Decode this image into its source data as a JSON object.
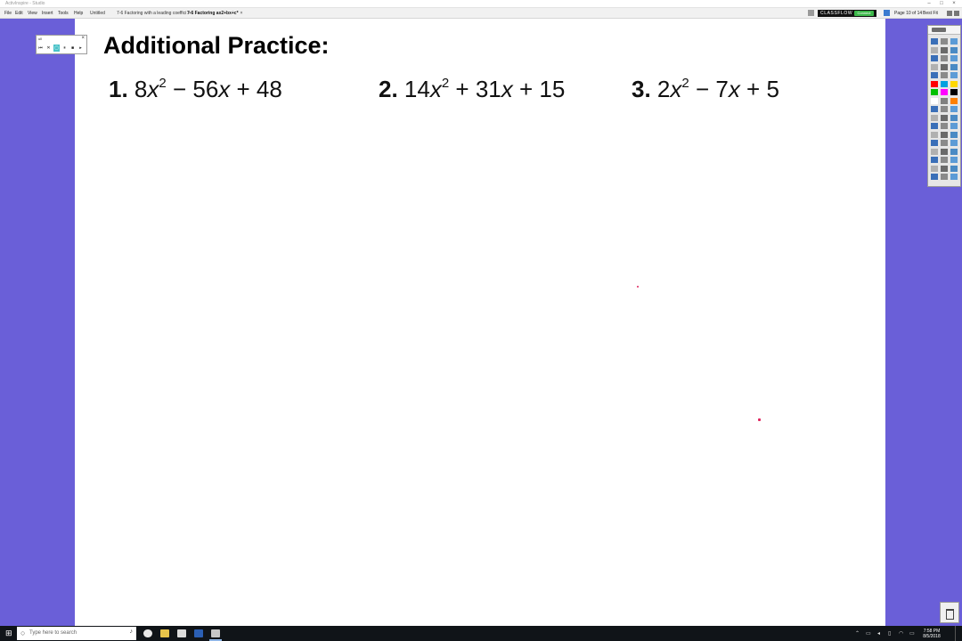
{
  "app": {
    "title": "ActivInspire - Studio",
    "menus": [
      "File",
      "Edit",
      "View",
      "Insert",
      "Tools",
      "Help"
    ],
    "tabs": [
      {
        "label": "Untitled",
        "active": false
      },
      {
        "label": "7-6 Factoring with a leading coeffici",
        "active": false
      },
      {
        "label": "7-6 Factoring ax2+bx+c*",
        "active": true
      }
    ],
    "tab_close": "×",
    "classflow_label": "CLASSFLOW",
    "classflow_button": "Connect",
    "page_info": "Page 10 of 14",
    "zoom": "Best Fit",
    "window_controls": [
      "–",
      "□",
      "×"
    ]
  },
  "mini_toolbar": {
    "title": "ull",
    "close": "×",
    "buttons": [
      "⏮",
      "✕",
      "▢",
      "⏸",
      "■",
      "▸"
    ]
  },
  "flipchart": {
    "heading": "Additional Practice:",
    "problems": [
      {
        "num": "1.",
        "coef": "8",
        "var": "x",
        "exp": "2",
        "rest": " − 56",
        "var2": "x",
        "tail": " + 48"
      },
      {
        "num": "2.",
        "coef": "14",
        "var": "x",
        "exp": "2",
        "rest": " + 31",
        "var2": "x",
        "tail": " + 15"
      },
      {
        "num": "3.",
        "coef": "2",
        "var": "x",
        "exp": "2",
        "rest": " − 7",
        "var2": "x",
        "tail": " + 5"
      }
    ],
    "ink_dot_color": "#e0245e"
  },
  "taskbar": {
    "start_icon": "windows-icon",
    "search_placeholder": "Type here to search",
    "time": "7:58 PM",
    "date": "8/5/2018"
  },
  "colors": {
    "background": "#6a5fd8",
    "page": "#ffffff",
    "taskbar": "#101418",
    "classflow_button": "#3cb84a"
  }
}
